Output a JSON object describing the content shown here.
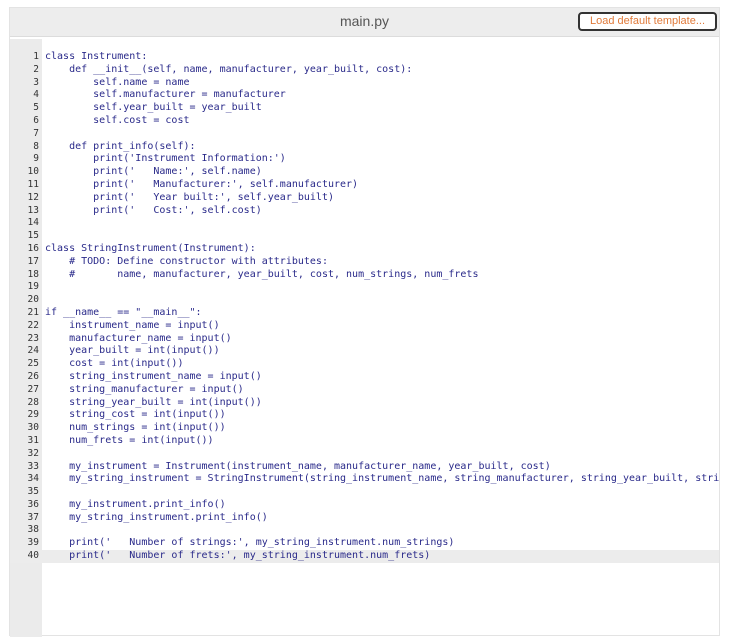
{
  "header": {
    "filename": "main.py",
    "load_button": "Load default template..."
  },
  "editor": {
    "language": "python",
    "active_line": 40,
    "lines": [
      "class Instrument:",
      "    def __init__(self, name, manufacturer, year_built, cost):",
      "        self.name = name",
      "        self.manufacturer = manufacturer",
      "        self.year_built = year_built",
      "        self.cost = cost",
      "",
      "    def print_info(self):",
      "        print('Instrument Information:')",
      "        print('   Name:', self.name)",
      "        print('   Manufacturer:', self.manufacturer)",
      "        print('   Year built:', self.year_built)",
      "        print('   Cost:', self.cost)",
      "",
      "",
      "class StringInstrument(Instrument):",
      "    # TODO: Define constructor with attributes:",
      "    #       name, manufacturer, year_built, cost, num_strings, num_frets",
      "",
      "",
      "if __name__ == \"__main__\":",
      "    instrument_name = input()",
      "    manufacturer_name = input()",
      "    year_built = int(input())",
      "    cost = int(input())",
      "    string_instrument_name = input()",
      "    string_manufacturer = input()",
      "    string_year_built = int(input())",
      "    string_cost = int(input())",
      "    num_strings = int(input())",
      "    num_frets = int(input())",
      "",
      "    my_instrument = Instrument(instrument_name, manufacturer_name, year_built, cost)",
      "    my_string_instrument = StringInstrument(string_instrument_name, string_manufacturer, string_year_built, string_co",
      "",
      "    my_instrument.print_info()",
      "    my_string_instrument.print_info()",
      "",
      "    print('   Number of strings:', my_string_instrument.num_strings)",
      "    print('   Number of frets:', my_string_instrument.num_frets)"
    ]
  }
}
